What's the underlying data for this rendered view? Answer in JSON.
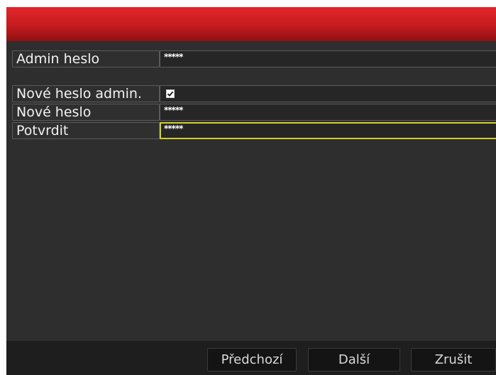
{
  "form": {
    "admin_password": {
      "label": "Admin heslo",
      "value": "*****"
    },
    "new_admin_password": {
      "label": "Nové heslo admin.",
      "checked": true
    },
    "new_password": {
      "label": "Nové heslo",
      "value": "*****"
    },
    "confirm": {
      "label": "Potvrdit",
      "value": "*****"
    }
  },
  "buttons": {
    "previous": "Předchozí",
    "next": "Další",
    "cancel": "Zrušit"
  },
  "colors": {
    "titlebar": "#d42024",
    "focus_border": "#cfcf2a",
    "panel": "#2e2e2e"
  }
}
